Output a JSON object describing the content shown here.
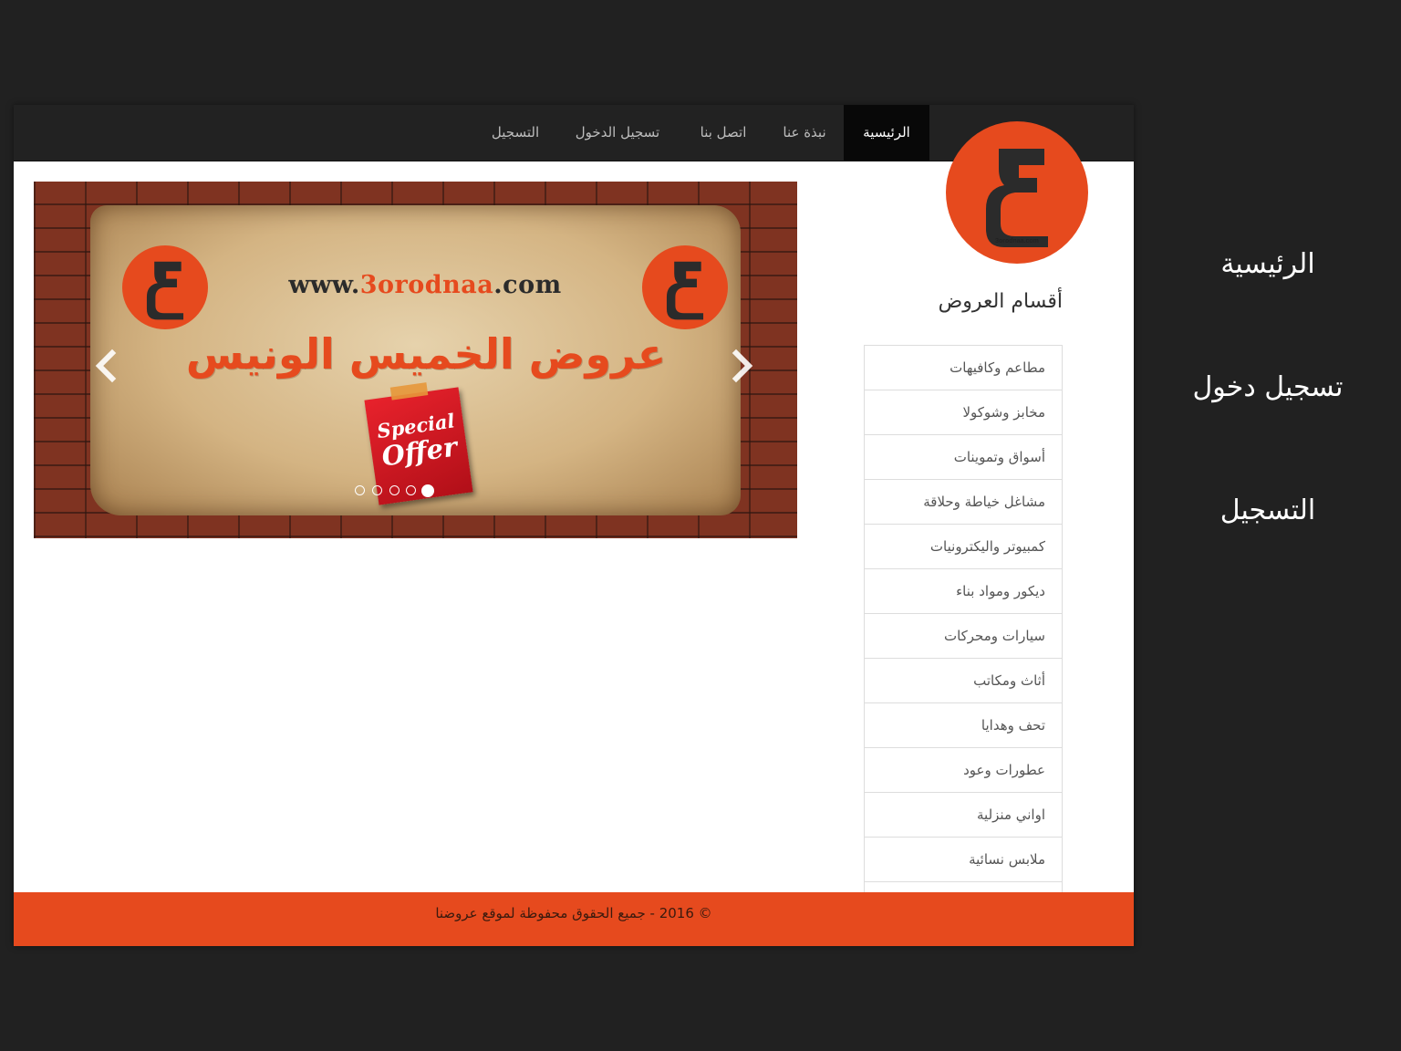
{
  "nav": {
    "items": [
      {
        "label": "الرئيسية",
        "active": true
      },
      {
        "label": "نبذة عنا",
        "active": false
      },
      {
        "label": "اتصل بنا",
        "active": false
      },
      {
        "label": "تسجيل الدخول",
        "active": false
      },
      {
        "label": "التسجيل",
        "active": false
      }
    ]
  },
  "logo": {
    "domain": "3orodnaa.com",
    "icon": "3orodnaa-logo-icon"
  },
  "slider": {
    "url_prefix": "www.",
    "url_accent": "3orodnaa",
    "url_suffix": ".com",
    "headline": "عروض الخميس الونيس",
    "offer_line1": "Special",
    "offer_line2": "Offer",
    "prev_icon": "chevron-left-icon",
    "next_icon": "chevron-right-icon",
    "slide_count": 5,
    "active_slide": 1
  },
  "categories": {
    "title": "أقسام العروض",
    "items": [
      "مطاعم وكافيهات",
      "مخابز وشوكولا",
      "أسواق وتموينات",
      "مشاغل خياطة وحلاقة",
      "كمبيوتر واليكترونيات",
      "ديكور ومواد بناء",
      "سيارات ومحركات",
      "أثاث ومكاتب",
      "تحف وهدايا",
      "عطورات وعود",
      "اواني منزلية",
      "ملابس نسائية"
    ]
  },
  "footer": {
    "text": "© 2016 - جميع الحقوق محفوظة لموقع عروضنا"
  },
  "side_menu": {
    "items": [
      "الرئيسية",
      "تسجيل دخول",
      "التسجيل"
    ]
  },
  "colors": {
    "accent": "#e64a1e",
    "navbar": "#222222",
    "nav_active": "#080808",
    "page_background": "#212121"
  }
}
